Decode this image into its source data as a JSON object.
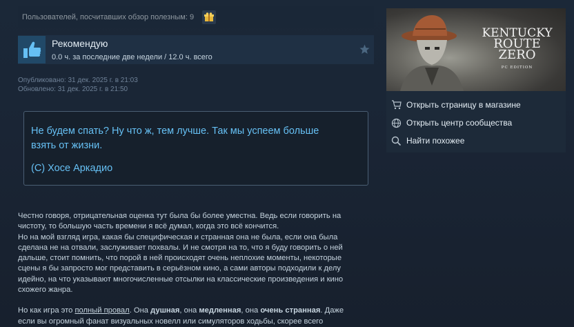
{
  "helpful": {
    "text": "Пользователей, посчитавших обзор полезным: 9",
    "award_icon": "award-icon"
  },
  "recommendation": {
    "title": "Рекомендую",
    "hours": "0.0 ч. за последние две недели / 12.0 ч. всего",
    "thumb_icon": "thumbs-up-icon",
    "star_icon": "star-icon"
  },
  "dates": {
    "published": "Опубликовано: 31 дек. 2025 г. в 21:03",
    "updated": "Обновлено: 31 дек. 2025 г. в 21:50"
  },
  "quote": {
    "line1": "Не будем спать? Ну что ж, тем лучше. Так мы успеем больше",
    "line2": "взять от жизни.",
    "author": "(С) Хосе Аркадио"
  },
  "body": {
    "p1_l1": "Честно говоря, отрицательная оценка тут была бы более уместна. Ведь если говорить на",
    "p1_l2": "чистоту, то большую часть времени я всё думал, когда это всё кончится.",
    "p1_l3": "Но на мой взгляд игра, какая бы специфическая и странная она не была, если она была",
    "p1_l4": "сделана не на отвали, заслуживает похвалы. И не смотря на то, что я буду говорить о ней",
    "p1_l5": "дальше, стоит помнить, что порой в ней происходят очень неплохие моменты, некоторые",
    "p1_l6": "сцены я бы запросто мог представить в серьёзном кино, а сами авторы подходили к делу",
    "p1_l7": "идейно, на что указывают многочисленные отсылки на классические произведения и кино",
    "p1_l8": "схожего жанра.",
    "p2_a": "Но как игра это ",
    "p2_u": "полный провал",
    "p2_b": ". Она ",
    "p2_bold1": "душная",
    "p2_c": ", она ",
    "p2_bold2": "медленная",
    "p2_d": ", она ",
    "p2_bold3": "очень странная",
    "p2_e": ". Даже",
    "p2_l2": "если вы огромный фанат визуальных новелл или симуляторов ходьбы, скорее всего"
  },
  "sidebar": {
    "banner": {
      "line1": "KENTUCKY",
      "line2": "ROUTE",
      "line3": "ZERO",
      "line4": "PC EDITION"
    },
    "links": [
      {
        "label": "Открыть страницу в магазине",
        "icon": "cart-icon"
      },
      {
        "label": "Открыть центр сообщества",
        "icon": "globe-icon"
      },
      {
        "label": "Найти похожее",
        "icon": "search-icon"
      }
    ]
  },
  "colors": {
    "background": "#1b2838",
    "accent": "#66c0f4",
    "text": "#c6d4df"
  }
}
